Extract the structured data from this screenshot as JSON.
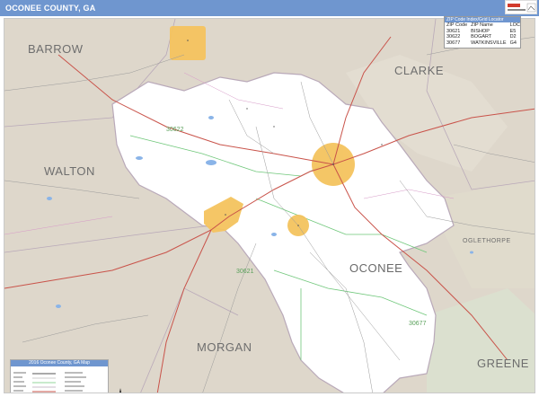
{
  "title": "OCONEE COUNTY, GA",
  "counties": {
    "barrow": "BARROW",
    "clarke": "CLARKE",
    "walton": "WALTON",
    "oglethorpe": "OGLETHORPE",
    "morgan": "MORGAN",
    "greene": "GREENE"
  },
  "main_county_label": "OCONEE",
  "zip_labels": [
    "30622",
    "30621",
    "30677"
  ],
  "zip_table": {
    "header": "ZIP Code Index/Grid Locator",
    "columns": [
      "ZIP Code",
      "ZIP Name",
      "LOC"
    ],
    "rows": [
      [
        "30621",
        "BISHOP",
        "E5"
      ],
      [
        "30622",
        "BOGART",
        "D2"
      ],
      [
        "30677",
        "WATKINSVILLE",
        "G4"
      ]
    ]
  },
  "legend": {
    "title": "2016 Oconee County, GA Map"
  },
  "colors": {
    "title_bar": "#6f96cf",
    "county_fill": "#ffffff",
    "outside_fill": "#ded7cb",
    "city_fill": "#f4c35e",
    "highway": "#c9534a",
    "road": "#9a9a9a",
    "zip_boundary": "#6fc77a",
    "water": "#8ab4e8"
  }
}
